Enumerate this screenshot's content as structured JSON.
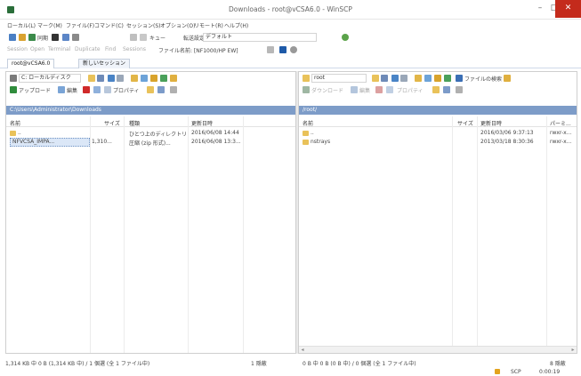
{
  "window": {
    "title": "Downloads - root@vCSA6.0 - WinSCP",
    "minimize": "–",
    "maximize": "□",
    "close": "✕"
  },
  "menu": [
    "ローカル(L)",
    "マーク(M)",
    "ファイル(F)",
    "コマンド(C)",
    "セッション(S)",
    "オプション(O)",
    "リモート(R)",
    "ヘルプ(H)"
  ],
  "toolbar1": {
    "sync_label": "同期",
    "queue_label": "キュー",
    "transfer_setting_label": "転送設定",
    "transfer_setting_value": "デフォルト"
  },
  "toolbar2": {
    "items": [
      "Session",
      "Open",
      "Terminal",
      "Duplicate",
      "Find",
      "Sessions"
    ],
    "site_label": "ファイル名前: [NF1000/HP EW]"
  },
  "tabs": {
    "session": "root@vCSA6.0",
    "new_session": "新しいセッション"
  },
  "left_pane": {
    "drive": "C: ローカルディスク",
    "upload_label": "アップロード",
    "edit_label": "編集",
    "properties_label": "プロパティ",
    "path": "C:\\Users\\Administrator\\Downloads",
    "columns": {
      "name": "名前",
      "size": "サイズ",
      "type": "種類",
      "modified": "更新日時"
    },
    "rows": [
      {
        "name": "..",
        "size": "",
        "type": "ひとつ上のディレクトリ",
        "modified": "2016/06/08 14:44"
      },
      {
        "name": "NFVCSA_IMPA...",
        "size": "1,310...",
        "type": "圧縮 (zip 形式)...",
        "modified": "2016/06/08 13:3..."
      }
    ],
    "status": "1,314 KB 中 0 B (1,314 KB 中) / 1 個選 (全 1 ファイル中)",
    "hidden_count": "1 隠蔽"
  },
  "right_pane": {
    "folder": "root",
    "download_label": "ダウンロード",
    "edit_label": "編集",
    "properties_label": "プロパティ",
    "find_label": "ファイルの検索",
    "path": "/root/",
    "columns": {
      "name": "名前",
      "size": "サイズ",
      "modified": "更新日時",
      "rights": "パーミ..."
    },
    "rows": [
      {
        "name": "..",
        "size": "",
        "modified": "2016/03/06 9:37:13",
        "rights": "rwxr-x..."
      },
      {
        "name": "nstrays",
        "size": "",
        "modified": "2013/03/18 8:30:36",
        "rights": "rwxr-x..."
      }
    ],
    "status": "0 B 中 0 B (0 B 中) / 0 個選 (全 1 ファイル中)",
    "hidden_count": "8 隠蔽"
  },
  "statusbar": {
    "protocol": "SCP",
    "time": "0:00:19"
  },
  "colors": {
    "path_bar": "#7d9cc8",
    "selection": "#dbe7f7",
    "close_button": "#c42b1c",
    "folder": "#e9c25a"
  }
}
